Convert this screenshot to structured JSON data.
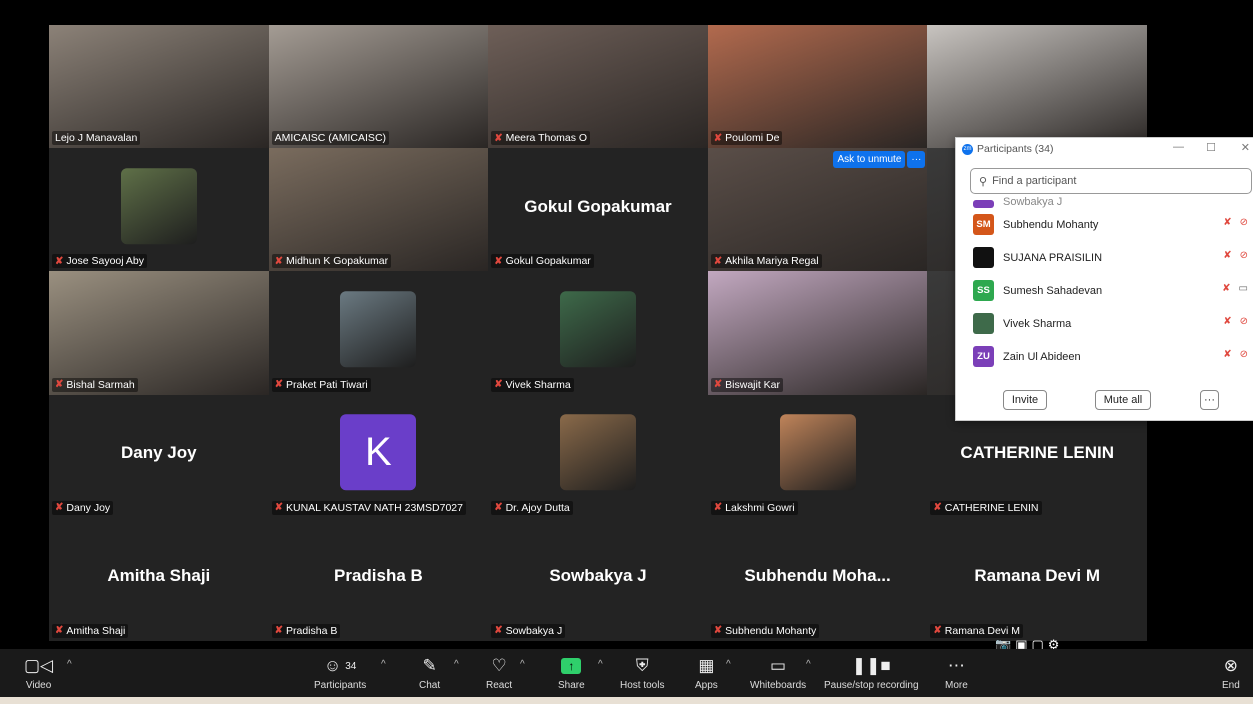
{
  "tiles": [
    {
      "name": "Lejo J Manavalan",
      "type": "video",
      "muted": false,
      "active": true,
      "bg": "#8c8278"
    },
    {
      "name": "AMICAISC (AMICAISC)",
      "type": "video",
      "muted": false,
      "bg": "#a49c94"
    },
    {
      "name": "Meera Thomas O",
      "type": "video",
      "muted": true,
      "bg": "#6e5f58"
    },
    {
      "name": "Poulomi De",
      "type": "video",
      "muted": true,
      "bg": "#b26a4e"
    },
    {
      "name": "",
      "type": "video",
      "muted": false,
      "bg": "#c8c4c0"
    },
    {
      "name": "Jose Sayooj Aby",
      "type": "photo",
      "muted": true,
      "bg": "#5f7048"
    },
    {
      "name": "Midhun K Gopakumar",
      "type": "video",
      "muted": true,
      "bg": "#7a6c5e"
    },
    {
      "name": "Gokul Gopakumar",
      "type": "text",
      "display": "Gokul Gopakumar",
      "muted": true
    },
    {
      "name": "Akhila Mariya Regal",
      "type": "video",
      "muted": true,
      "bg": "#5a4e48",
      "ask_unmute": "Ask to unmute",
      "more": "···"
    },
    {
      "name": "",
      "type": "video",
      "muted": false,
      "bg": "#3a3a3a"
    },
    {
      "name": "Bishal Sarmah",
      "type": "video",
      "muted": true,
      "bg": "#9a9080"
    },
    {
      "name": "Praket Pati Tiwari",
      "type": "photo",
      "muted": true,
      "bg": "#6b7a82"
    },
    {
      "name": "Vivek Sharma",
      "type": "photo",
      "muted": true,
      "bg": "#3e6a4a"
    },
    {
      "name": "Biswajit Kar",
      "type": "video",
      "muted": true,
      "bg": "#c2a8c0"
    },
    {
      "name": "",
      "type": "video",
      "muted": false,
      "bg": "#3a3a3a"
    },
    {
      "name": "Dany Joy",
      "type": "text",
      "display": "Dany Joy",
      "muted": true
    },
    {
      "name": "KUNAL KAUSTAV NATH 23MSD7027",
      "type": "letter",
      "letter": "K",
      "muted": true
    },
    {
      "name": "Dr. Ajoy Dutta",
      "type": "photo",
      "muted": true,
      "bg": "#8a6a4a"
    },
    {
      "name": "Lakshmi Gowri",
      "type": "photo",
      "muted": true,
      "bg": "#c0845a"
    },
    {
      "name": "CATHERINE LENIN",
      "type": "text",
      "display": "CATHERINE LENIN",
      "muted": true
    },
    {
      "name": "Amitha Shaji",
      "type": "text",
      "display": "Amitha Shaji",
      "muted": true
    },
    {
      "name": "Pradisha B",
      "type": "text",
      "display": "Pradisha B",
      "muted": true
    },
    {
      "name": "Sowbakya J",
      "type": "text",
      "display": "Sowbakya J",
      "muted": true
    },
    {
      "name": "Subhendu Mohanty",
      "type": "text",
      "display": "Subhendu  Moha...",
      "muted": true
    },
    {
      "name": "Ramana Devi M",
      "type": "text",
      "display": "Ramana Devi M",
      "muted": true
    }
  ],
  "panel": {
    "title": "Participants (34)",
    "search_placeholder": "Find a participant",
    "partial_row": "Sowbakya J",
    "participants": [
      {
        "initials": "SM",
        "name": "Subhendu Mohanty",
        "color": "#d4561a",
        "camera_icon": "video-off-icon"
      },
      {
        "initials": "",
        "name": "SUJANA PRAISILIN",
        "color": "#111111",
        "camera_icon": "video-off-icon"
      },
      {
        "initials": "SS",
        "name": "Sumesh Sahadevan",
        "color": "#2ea84f",
        "camera_icon": "video-on-icon"
      },
      {
        "initials": "",
        "name": "Vivek Sharma",
        "color": "#3e6a4a",
        "camera_icon": "video-off-icon"
      },
      {
        "initials": "ZU",
        "name": "Zain Ul Abideen",
        "color": "#7b3fb8",
        "camera_icon": "video-off-icon"
      }
    ],
    "invite": "Invite",
    "mute_all": "Mute all",
    "more": "···"
  },
  "toolbar": {
    "video": "Video",
    "participants": "Participants",
    "participant_count": "34",
    "chat": "Chat",
    "react": "React",
    "share": "Share",
    "host_tools": "Host tools",
    "apps": "Apps",
    "whiteboards": "Whiteboards",
    "recording": "Pause/stop recording",
    "more": "More",
    "end": "End"
  }
}
